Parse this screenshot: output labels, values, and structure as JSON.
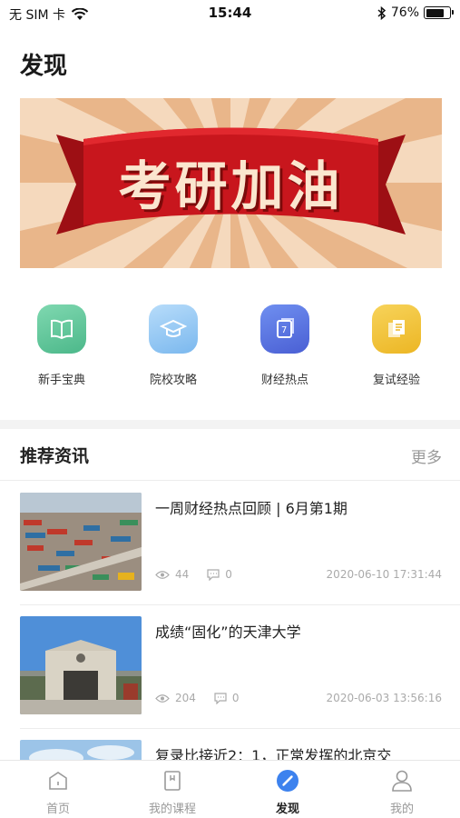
{
  "status_bar": {
    "carrier": "无 SIM 卡",
    "time": "15:44",
    "battery": "76%",
    "battery_level": 0.76
  },
  "page_title": "发现",
  "banner": {
    "text": "考研加油"
  },
  "quick_entries": [
    {
      "label": "新手宝典",
      "icon": "book-icon",
      "color": "#5cc49a"
    },
    {
      "label": "院校攻略",
      "icon": "graduation-cap-icon",
      "color": "#8fc6f2"
    },
    {
      "label": "财经热点",
      "icon": "finance-news-icon",
      "color": "#5a74e0"
    },
    {
      "label": "复试经验",
      "icon": "documents-icon",
      "color": "#f2c43c"
    }
  ],
  "recommend": {
    "title": "推荐资讯",
    "more": "更多",
    "items": [
      {
        "title": "一周财经热点回顾 | 6月第1期",
        "views": "44",
        "comments": "0",
        "date": "2020-06-10 17:31:44"
      },
      {
        "title": "成绩“固化”的天津大学",
        "views": "204",
        "comments": "0",
        "date": "2020-06-03 13:56:16"
      },
      {
        "title": "复录比接近2：1，正常发挥的北京交",
        "views": "",
        "comments": "",
        "date": ""
      }
    ]
  },
  "tabbar": {
    "items": [
      {
        "label": "首页",
        "icon": "home-icon"
      },
      {
        "label": "我的课程",
        "icon": "course-icon"
      },
      {
        "label": "发现",
        "icon": "compass-icon",
        "active": true
      },
      {
        "label": "我的",
        "icon": "user-icon"
      }
    ]
  },
  "colors": {
    "accent": "#3d82ee",
    "banner_red": "#c8161d"
  }
}
